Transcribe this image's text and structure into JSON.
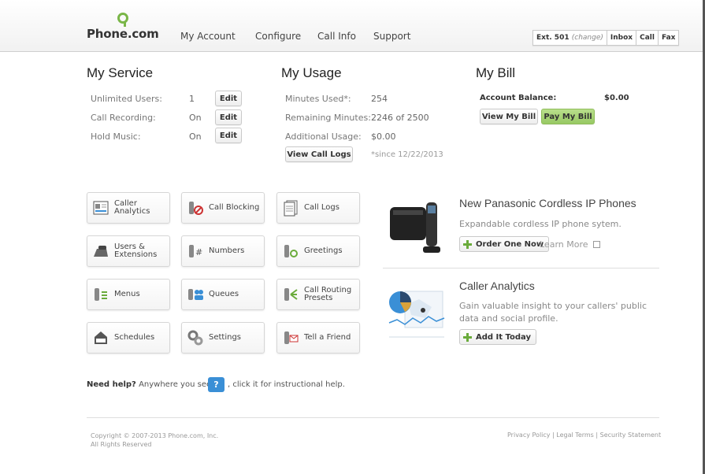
{
  "header": {
    "logo": "Phone.com",
    "nav": [
      "My Account",
      "Configure",
      "Call Info",
      "Support"
    ],
    "ext_label": "Ext. 501",
    "ext_change": "(change)",
    "inbox": "Inbox",
    "call": "Call",
    "fax": "Fax"
  },
  "my_service": {
    "title": "My Service",
    "rows": [
      {
        "label": "Unlimited Users:",
        "value": "1",
        "button": "Edit"
      },
      {
        "label": "Call Recording:",
        "value": "On",
        "button": "Edit"
      },
      {
        "label": "Hold Music:",
        "value": "On",
        "button": "Edit"
      }
    ]
  },
  "my_usage": {
    "title": "My Usage",
    "rows": [
      {
        "label": "Minutes Used*:",
        "value": "254"
      },
      {
        "label": "Remaining Minutes:",
        "value": "2246 of 2500"
      },
      {
        "label": "Additional Usage:",
        "value": "$0.00"
      }
    ],
    "view_logs": "View Call Logs",
    "since": "*since 12/22/2013"
  },
  "my_bill": {
    "title": "My Bill",
    "balance_label": "Account Balance:",
    "balance_value": "$0.00",
    "view_bill": "View My Bill",
    "pay_bill": "Pay My Bill"
  },
  "tiles": [
    {
      "label": "Caller\nAnalytics",
      "icon": "caller-analytics-icon"
    },
    {
      "label": "Call Blocking",
      "icon": "call-blocking-icon"
    },
    {
      "label": "Call Logs",
      "icon": "call-logs-icon"
    },
    {
      "label": "Users &\nExtensions",
      "icon": "users-extensions-icon"
    },
    {
      "label": "Numbers",
      "icon": "numbers-icon"
    },
    {
      "label": "Greetings",
      "icon": "greetings-icon"
    },
    {
      "label": "Menus",
      "icon": "menus-icon"
    },
    {
      "label": "Queues",
      "icon": "queues-icon"
    },
    {
      "label": "Call Routing\nPresets",
      "icon": "call-routing-icon"
    },
    {
      "label": "Schedules",
      "icon": "schedules-icon"
    },
    {
      "label": "Settings",
      "icon": "settings-icon"
    },
    {
      "label": "Tell a Friend",
      "icon": "tell-a-friend-icon"
    }
  ],
  "promo_phones": {
    "title": "New Panasonic Cordless IP Phones",
    "desc": "Expandable cordless IP phone sytem.",
    "order": "Order One Now",
    "learn": "Learn More"
  },
  "promo_analytics": {
    "title": "Caller Analytics",
    "desc": "Gain valuable insight to your callers' public data and social profile.",
    "add": "Add It Today"
  },
  "help": {
    "bold": "Need help?",
    "text1": "Anywhere you see",
    "q": "?",
    "text2": ", click it for instructional help."
  },
  "footer": {
    "copyright": "Copyright © 2007-2013 Phone.com, Inc.",
    "rights": "All Rights Reserved",
    "links": "Privacy Policy | Legal Terms | Security Statement"
  }
}
